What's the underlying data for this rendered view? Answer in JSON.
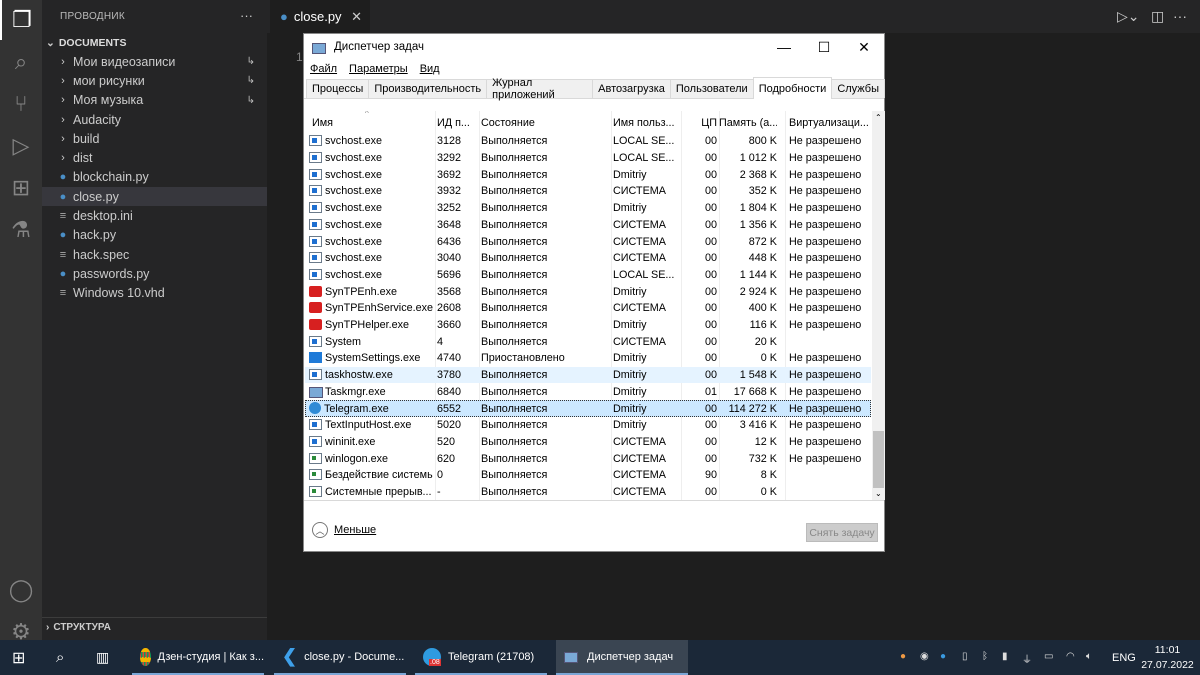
{
  "vscode": {
    "activity": [
      "explorer-icon",
      "search-icon",
      "source-control-icon",
      "run-debug-icon",
      "extensions-icon",
      "testing-icon",
      "account-icon",
      "settings-gear-icon"
    ],
    "sidebar_title": "ПРОВОДНИК",
    "more": "···",
    "section": "DOCUMENTS",
    "items": [
      {
        "label": "Мои видеозаписи",
        "type": "folder",
        "link": "↳"
      },
      {
        "label": "мои рисунки",
        "type": "folder",
        "link": "↳"
      },
      {
        "label": "Моя музыка",
        "type": "folder",
        "link": "↳"
      },
      {
        "label": "Audacity",
        "type": "folder"
      },
      {
        "label": "build",
        "type": "folder"
      },
      {
        "label": "dist",
        "type": "folder"
      },
      {
        "label": "blockchain.py",
        "type": "py"
      },
      {
        "label": "close.py",
        "type": "py",
        "selected": true
      },
      {
        "label": "desktop.ini",
        "type": "text"
      },
      {
        "label": "hack.py",
        "type": "py"
      },
      {
        "label": "hack.spec",
        "type": "text"
      },
      {
        "label": "passwords.py",
        "type": "py"
      },
      {
        "label": "Windows 10.vhd",
        "type": "text"
      }
    ],
    "outline": "СТРУКТУРА",
    "tab": "close.py",
    "line_number": "1"
  },
  "taskmgr": {
    "title": "Диспетчер задач",
    "menu": [
      "Файл",
      "Параметры",
      "Вид"
    ],
    "tabs": [
      "Процессы",
      "Производительность",
      "Журнал приложений",
      "Автозагрузка",
      "Пользователи",
      "Подробности",
      "Службы"
    ],
    "active_tab": "Подробности",
    "columns": [
      "Имя",
      "ИД п...",
      "Состояние",
      "Имя польз...",
      "ЦП",
      "Память (а...",
      "Виртуализаци..."
    ],
    "rows": [
      [
        "svchost.exe",
        "3128",
        "Выполняется",
        "LOCAL SE...",
        "00",
        "800 K",
        "Не разрешено",
        "svc"
      ],
      [
        "svchost.exe",
        "3292",
        "Выполняется",
        "LOCAL SE...",
        "00",
        "1 012 K",
        "Не разрешено",
        "svc"
      ],
      [
        "svchost.exe",
        "3692",
        "Выполняется",
        "Dmitriy",
        "00",
        "2 368 K",
        "Не разрешено",
        "svc"
      ],
      [
        "svchost.exe",
        "3932",
        "Выполняется",
        "СИСТЕМА",
        "00",
        "352 K",
        "Не разрешено",
        "svc"
      ],
      [
        "svchost.exe",
        "3252",
        "Выполняется",
        "Dmitriy",
        "00",
        "1 804 K",
        "Не разрешено",
        "svc"
      ],
      [
        "svchost.exe",
        "3648",
        "Выполняется",
        "СИСТЕМА",
        "00",
        "1 356 K",
        "Не разрешено",
        "svc"
      ],
      [
        "svchost.exe",
        "6436",
        "Выполняется",
        "СИСТЕМА",
        "00",
        "872 K",
        "Не разрешено",
        "svc"
      ],
      [
        "svchost.exe",
        "3040",
        "Выполняется",
        "СИСТЕМА",
        "00",
        "448 K",
        "Не разрешено",
        "svc"
      ],
      [
        "svchost.exe",
        "5696",
        "Выполняется",
        "LOCAL SE...",
        "00",
        "1 144 K",
        "Не разрешено",
        "svc"
      ],
      [
        "SynTPEnh.exe",
        "3568",
        "Выполняется",
        "Dmitriy",
        "00",
        "2 924 K",
        "Не разрешено",
        "syn"
      ],
      [
        "SynTPEnhService.exe",
        "2608",
        "Выполняется",
        "СИСТЕМА",
        "00",
        "400 K",
        "Не разрешено",
        "syn"
      ],
      [
        "SynTPHelper.exe",
        "3660",
        "Выполняется",
        "Dmitriy",
        "00",
        "116 K",
        "Не разрешено",
        "syn"
      ],
      [
        "System",
        "4",
        "Выполняется",
        "СИСТЕМА",
        "00",
        "20 K",
        "",
        "svc"
      ],
      [
        "SystemSettings.exe",
        "4740",
        "Приостановлено",
        "Dmitriy",
        "00",
        "0 K",
        "Не разрешено",
        "gear"
      ],
      [
        "taskhostw.exe",
        "3780",
        "Выполняется",
        "Dmitriy",
        "00",
        "1 548 K",
        "Не разрешено",
        "svc"
      ],
      [
        "Taskmgr.exe",
        "6840",
        "Выполняется",
        "Dmitriy",
        "01",
        "17 668 K",
        "Не разрешено",
        "tm"
      ],
      [
        "Telegram.exe",
        "6552",
        "Выполняется",
        "Dmitriy",
        "00",
        "114 272 K",
        "Не разрешено",
        "tg"
      ],
      [
        "TextInputHost.exe",
        "5020",
        "Выполняется",
        "Dmitriy",
        "00",
        "3 416 K",
        "Не разрешено",
        "svc"
      ],
      [
        "wininit.exe",
        "520",
        "Выполняется",
        "СИСТЕМА",
        "00",
        "12 K",
        "Не разрешено",
        "svc"
      ],
      [
        "winlogon.exe",
        "620",
        "Выполняется",
        "СИСТЕМА",
        "00",
        "732 K",
        "Не разрешено",
        "gray"
      ],
      [
        "Бездействие системы",
        "0",
        "Выполняется",
        "СИСТЕМА",
        "90",
        "8 K",
        "",
        "gray"
      ],
      [
        "Системные прерыв...",
        "-",
        "Выполняется",
        "СИСТЕМА",
        "00",
        "0 K",
        "",
        "gray"
      ]
    ],
    "hovered_row": "taskhostw.exe",
    "selected_row": "Telegram.exe",
    "less": "Меньше",
    "end_task": "Снять задачу"
  },
  "taskbar": {
    "apps": [
      {
        "label": "Дзен-студия | Как з...",
        "icon": "chrome-icon"
      },
      {
        "label": "close.py - Docume...",
        "icon": "vscode-icon"
      },
      {
        "label": "Telegram (21708)",
        "icon": "telegram-icon",
        "badge": ".08"
      },
      {
        "label": "Диспетчер задач",
        "icon": "taskmgr-icon",
        "active": true
      }
    ],
    "lang": "ENG",
    "time": "11:01",
    "date": "27.07.2022"
  }
}
